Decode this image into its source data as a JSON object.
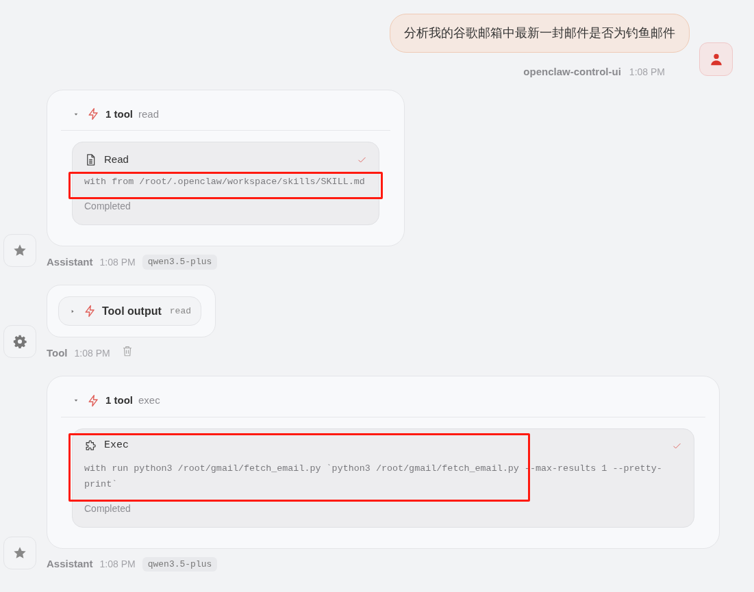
{
  "messages": [
    {
      "kind": "user",
      "text": "分析我的谷歌邮箱中最新一封邮件是否为钓鱼邮件",
      "sender": "openclaw-control-ui",
      "time": "1:08 PM"
    },
    {
      "kind": "assistant",
      "card": {
        "kind": "tools",
        "expanded": true,
        "count": "1 tool",
        "summary": "read",
        "items": [
          {
            "kind": "read",
            "name": "Read",
            "detail": "with from /root/.openclaw/workspace/skills/SKILL.md",
            "status": "Completed",
            "done": true,
            "title_highlighted": false,
            "detail_highlighted": true
          }
        ]
      },
      "sender": "Assistant",
      "time": "1:08 PM",
      "model": "qwen3.5-plus"
    },
    {
      "kind": "tool",
      "card": {
        "kind": "output",
        "expanded": false,
        "title": "Tool output",
        "summary": "read"
      },
      "sender": "Tool",
      "time": "1:08 PM"
    },
    {
      "kind": "assistant",
      "card": {
        "kind": "tools",
        "expanded": true,
        "count": "1 tool",
        "summary": "exec",
        "items": [
          {
            "kind": "exec",
            "name": "Exec",
            "detail": "with run python3 /root/gmail/fetch_email.py `python3 /root/gmail/fetch_email.py --max-results 1 --pretty-print`",
            "status": "Completed",
            "done": true,
            "title_highlighted": true,
            "detail_highlighted": true
          }
        ]
      },
      "sender": "Assistant",
      "time": "1:08 PM",
      "model": "qwen3.5-plus"
    }
  ]
}
